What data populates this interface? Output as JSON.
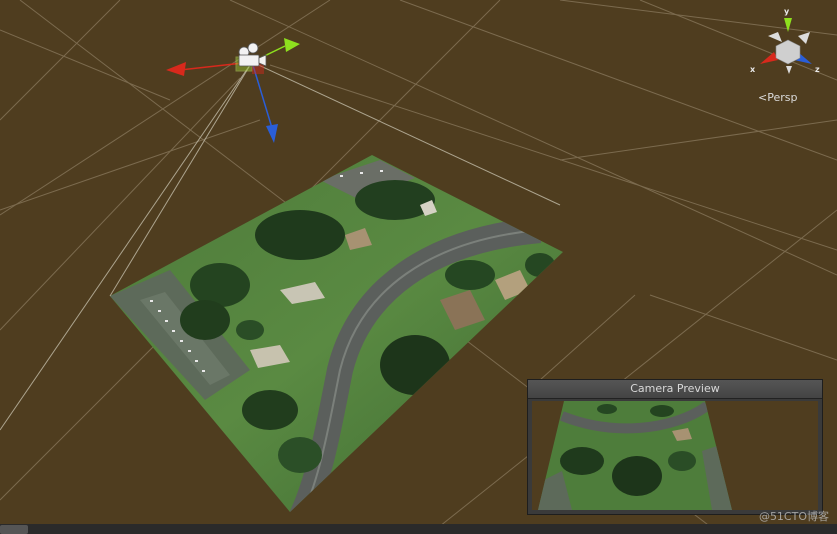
{
  "scene_view": {
    "projection_label": "Persp",
    "background_color": "#4f3d1f"
  },
  "orientation_gizmo": {
    "axes": {
      "y": "y",
      "x": "x",
      "z": "z"
    },
    "colors": {
      "y": "#8ee01e",
      "x": "#d8291c",
      "z": "#2a5ed8"
    }
  },
  "camera_object": {
    "icon": "camera-icon",
    "handle_colors": {
      "x": "#d8291c",
      "y": "#8ee01e",
      "z": "#2a5ed8"
    }
  },
  "camera_preview": {
    "title": "Camera Preview"
  },
  "watermark": "@51CTO博客"
}
